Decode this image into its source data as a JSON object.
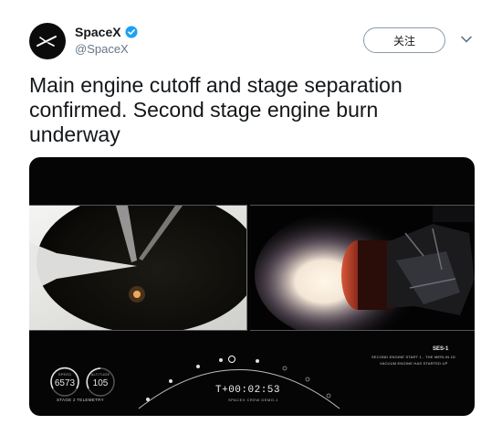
{
  "account": {
    "name": "SpaceX",
    "handle": "@SpaceX"
  },
  "follow_label": "关注",
  "tweet_text": "Main engine cutoff and stage separation confirmed. Second stage engine burn underway",
  "video": {
    "gauges": [
      {
        "value": "6573",
        "label": "SPEED"
      },
      {
        "value": "105",
        "label": "ALTITUDE"
      }
    ],
    "telemetry_label": "STAGE 2 TELEMETRY",
    "clock": "T+00:02:53",
    "mission_label": "SPACEX CREW DEMO-1",
    "payload_title": "SES-1",
    "status_lines": [
      "SECOND ENGINE START 1 - THE MERLIN 1D",
      "VACUUM ENGINE HAS STARTED UP"
    ]
  },
  "colors": {
    "verified": "#1da1f2",
    "text": "#14171a",
    "muted": "#657786"
  }
}
